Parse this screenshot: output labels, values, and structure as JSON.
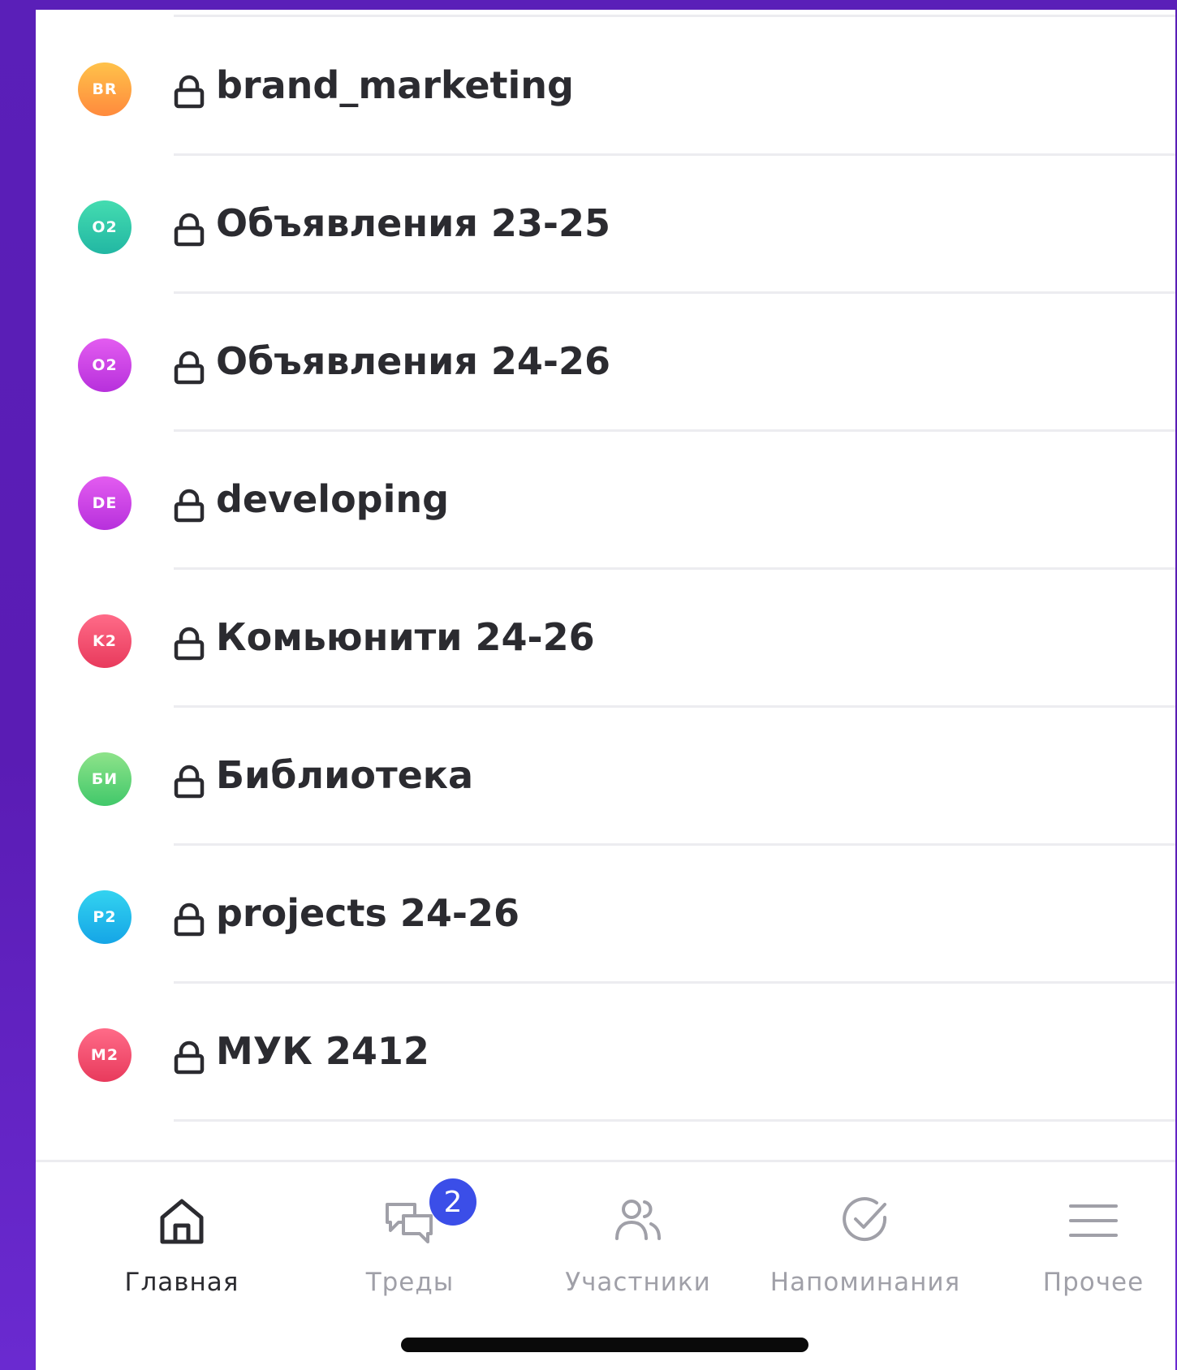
{
  "channels": [
    {
      "initials": "BR",
      "name": "brand_marketing",
      "color_from": "#ffc24a",
      "color_to": "#ff8a3d"
    },
    {
      "initials": "O2",
      "name": "Объявления 23-25",
      "color_from": "#44dcb0",
      "color_to": "#22b7a3"
    },
    {
      "initials": "O2",
      "name": "Объявления 24-26",
      "color_from": "#e35cf0",
      "color_to": "#b730dc"
    },
    {
      "initials": "DE",
      "name": "developing",
      "color_from": "#e35cf0",
      "color_to": "#b730dc"
    },
    {
      "initials": "K2",
      "name": "Комьюнити 24-26",
      "color_from": "#ff6b88",
      "color_to": "#e83a5c"
    },
    {
      "initials": "БИ",
      "name": "Библиотека",
      "color_from": "#8ee38a",
      "color_to": "#41c86a"
    },
    {
      "initials": "P2",
      "name": "projects 24-26",
      "color_from": "#33d3f0",
      "color_to": "#15a5e6"
    },
    {
      "initials": "M2",
      "name": "МУК 2412",
      "color_from": "#ff6b88",
      "color_to": "#e83a5c"
    }
  ],
  "tabbar": {
    "home": "Главная",
    "threads": "Треды",
    "threads_badge": "2",
    "members": "Участники",
    "reminders": "Напоминания",
    "more": "Прочее"
  }
}
